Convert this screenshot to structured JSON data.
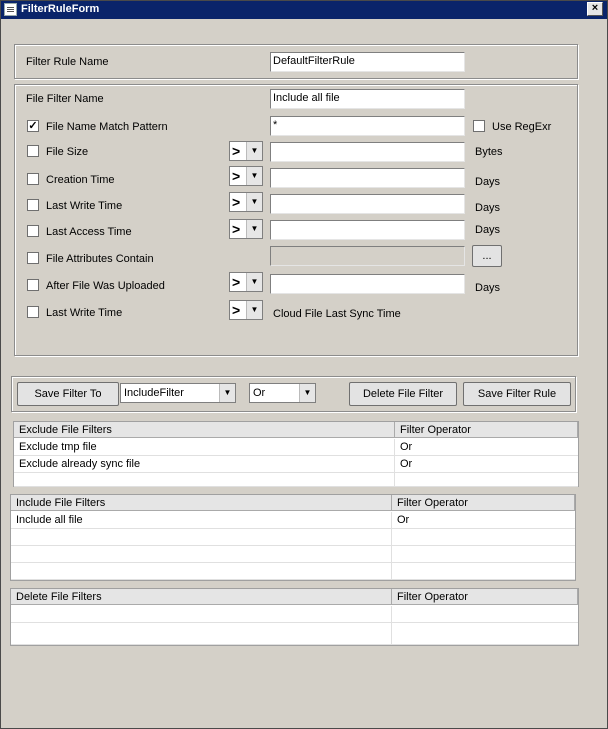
{
  "window": {
    "title": "FilterRuleForm",
    "close_glyph": "×"
  },
  "filter_rule": {
    "label": "Filter Rule Name",
    "value": "DefaultFilterRule"
  },
  "file_filter": {
    "name_label": "File Filter Name",
    "name_value": "Include all file",
    "rows": [
      {
        "label": "File Name Match Pattern",
        "checked": true,
        "operator": "",
        "value": "*",
        "suffix": "",
        "extra_check_label": "Use RegExr"
      },
      {
        "label": "File Size",
        "checked": false,
        "operator": ">",
        "value": "",
        "suffix": "Bytes"
      },
      {
        "label": "Creation Time",
        "checked": false,
        "operator": ">",
        "value": "",
        "suffix": "Days"
      },
      {
        "label": "Last Write Time",
        "checked": false,
        "operator": ">",
        "value": "",
        "suffix": "Days"
      },
      {
        "label": "Last Access Time",
        "checked": false,
        "operator": ">",
        "value": "",
        "suffix": "Days"
      },
      {
        "label": "File Attributes Contain",
        "checked": false,
        "operator": "",
        "value": "",
        "suffix": "",
        "button": "..."
      },
      {
        "label": "After File Was Uploaded",
        "checked": false,
        "operator": ">",
        "value": "",
        "suffix": "Days"
      },
      {
        "label": "Last Write Time",
        "checked": false,
        "operator": ">",
        "value": "",
        "suffix": "",
        "note": "Cloud File Last Sync Time"
      }
    ]
  },
  "actions": {
    "save_to_label": "Save Filter To",
    "target_value": "IncludeFilter",
    "operator_value": "Or",
    "delete_label": "Delete File Filter",
    "save_rule_label": "Save Filter Rule"
  },
  "exclude_grid": {
    "headers": [
      "Exclude File Filters",
      "Filter Operator"
    ],
    "rows": [
      [
        "Exclude tmp file",
        "Or"
      ],
      [
        "Exclude already sync file",
        "Or"
      ],
      [
        "",
        ""
      ]
    ]
  },
  "include_grid": {
    "headers": [
      "Include File Filters",
      "Filter Operator"
    ],
    "rows": [
      [
        "Include all file",
        "Or"
      ],
      [
        "",
        ""
      ],
      [
        "",
        ""
      ],
      [
        "",
        ""
      ]
    ]
  },
  "delete_grid": {
    "headers": [
      "Delete File Filters",
      "Filter Operator"
    ],
    "rows": [
      [
        "",
        ""
      ],
      [
        "",
        ""
      ]
    ]
  }
}
